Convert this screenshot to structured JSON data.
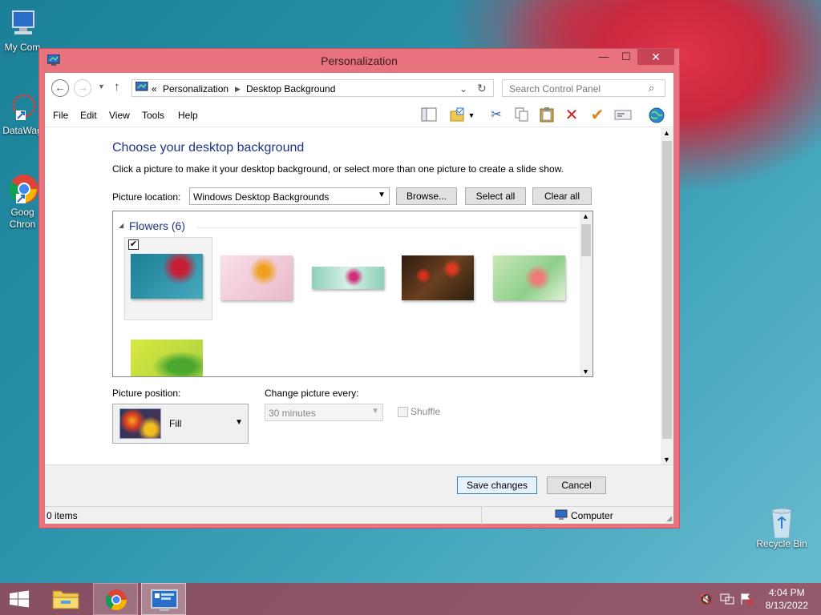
{
  "desktop": {
    "icons": [
      {
        "label": "My Com"
      },
      {
        "label": "DataWag"
      },
      {
        "label_line1": "Goog",
        "label_line2": "Chron"
      },
      {
        "label": "Recycle Bin"
      }
    ]
  },
  "window": {
    "title": "Personalization",
    "controls": {
      "minimize": "—",
      "maximize": "☐",
      "close": "✕"
    }
  },
  "address": {
    "prefix": "«",
    "crumbs": [
      "Personalization",
      "Desktop Background"
    ],
    "search_placeholder": "Search Control Panel"
  },
  "menu": [
    "File",
    "Edit",
    "View",
    "Tools",
    "Help"
  ],
  "content": {
    "heading": "Choose your desktop background",
    "description": "Click a picture to make it your desktop background, or select more than one picture to create a slide show.",
    "picture_location_label": "Picture location:",
    "picture_location_value": "Windows Desktop Backgrounds",
    "browse_label": "Browse...",
    "select_all_label": "Select all",
    "clear_all_label": "Clear all",
    "group_label": "Flowers (6)",
    "thumbnails": [
      {
        "name": "red-flower-teal",
        "selected": true
      },
      {
        "name": "orange-flower-pink",
        "selected": false
      },
      {
        "name": "pink-flower-mint",
        "selected": false
      },
      {
        "name": "red-tulips-dark",
        "selected": false
      },
      {
        "name": "pink-flower-green",
        "selected": false
      },
      {
        "name": "green-leaves-yellow",
        "selected": false
      }
    ],
    "picture_position_label": "Picture position:",
    "picture_position_value": "Fill",
    "change_every_label": "Change picture every:",
    "change_every_value": "30 minutes",
    "shuffle_label": "Shuffle"
  },
  "footer": {
    "save_label": "Save changes",
    "cancel_label": "Cancel"
  },
  "status": {
    "items": "0 items",
    "location": "Computer"
  },
  "taskbar": {
    "time": "4:04 PM",
    "date": "8/13/2022"
  },
  "colors": {
    "heading": "#1e3287",
    "window_frame": "#e8737f",
    "close_button": "#c84353",
    "taskbar": "#a03c4e"
  }
}
